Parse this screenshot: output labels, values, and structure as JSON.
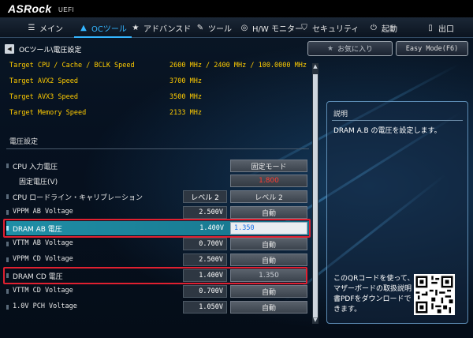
{
  "brand": {
    "logo": "ASRock",
    "sub": "UEFI"
  },
  "tabs": [
    {
      "label": "メイン",
      "icon": "grid-icon"
    },
    {
      "label": "OCツール",
      "icon": "rocket-icon",
      "active": true
    },
    {
      "label": "アドバンスド",
      "icon": "star-icon"
    },
    {
      "label": "ツール",
      "icon": "wrench-icon"
    },
    {
      "label": "H/W モニター",
      "icon": "monitor-icon"
    },
    {
      "label": "セキュリティ",
      "icon": "shield-icon"
    },
    {
      "label": "起動",
      "icon": "power-icon"
    },
    {
      "label": "出口",
      "icon": "exit-icon"
    }
  ],
  "breadcrumb": "OCツール\\電圧設定",
  "buttons": {
    "favorite": "お気に入り",
    "easy_mode": "Easy Mode(F6)"
  },
  "targets": [
    {
      "label": "Target CPU / Cache / BCLK Speed",
      "value": "2600 MHz / 2400 MHz / 100.0000 MHz"
    },
    {
      "label": "Target AVX2 Speed",
      "value": "3700 MHz"
    },
    {
      "label": "Target AVX3 Speed",
      "value": "3500 MHz"
    },
    {
      "label": "Target Memory Speed",
      "value": "2133 MHz"
    }
  ],
  "section_title": "電圧設定",
  "settings": [
    {
      "label": "CPU 入力電圧",
      "current": "",
      "value": "固定モード"
    },
    {
      "label": "固定電圧(V)",
      "current": "",
      "value": "1.800"
    },
    {
      "label": "CPU ロードライン・キャリブレーション",
      "current": "レベル 2",
      "value": "レベル 2"
    },
    {
      "label": "VPPM AB  Voltage",
      "current": "2.500V",
      "value": "自動"
    },
    {
      "label": "DRAM AB 電圧",
      "current": "1.400V",
      "value": "1.350"
    },
    {
      "label": "VTTM AB  Voltage",
      "current": "0.700V",
      "value": "自動"
    },
    {
      "label": "VPPM CD  Voltage",
      "current": "2.500V",
      "value": "自動"
    },
    {
      "label": "DRAM CD 電圧",
      "current": "1.400V",
      "value": "1.350"
    },
    {
      "label": "VTTM CD  Voltage",
      "current": "0.700V",
      "value": "自動"
    },
    {
      "label": "1.0V PCH Voltage",
      "current": "1.050V",
      "value": "自動"
    }
  ],
  "help": {
    "title": "説明",
    "text": "DRAM A.B の電圧を設定します。",
    "qr_text": "このQRコードを使って、マザーボードの取扱説明書PDFをダウンロードできます。"
  },
  "colors": {
    "accent": "#34b5ff",
    "highlight": "#1f8ea6",
    "target": "#ffcc00",
    "alert": "#e02030"
  }
}
